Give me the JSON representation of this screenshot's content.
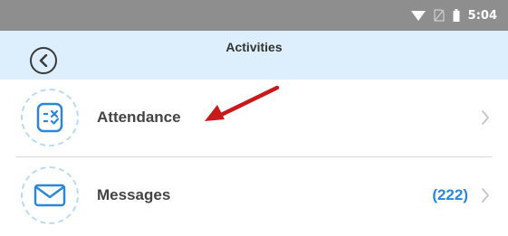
{
  "status_bar": {
    "time": "5:04",
    "icons": [
      "wifi-icon",
      "no-sim-icon",
      "battery-icon"
    ]
  },
  "header": {
    "title": "Activities",
    "back_icon": "back-circle-icon"
  },
  "activities": [
    {
      "label": "Attendance",
      "icon": "checklist-icon",
      "count": ""
    },
    {
      "label": "Messages",
      "icon": "envelope-icon",
      "count": "(222)"
    }
  ],
  "colors": {
    "status_bar": "#8e8e8e",
    "header": "#ddeefc",
    "icon_accent": "#2f86d6",
    "count": "#2f86d6",
    "arrow": "#c8191b"
  }
}
